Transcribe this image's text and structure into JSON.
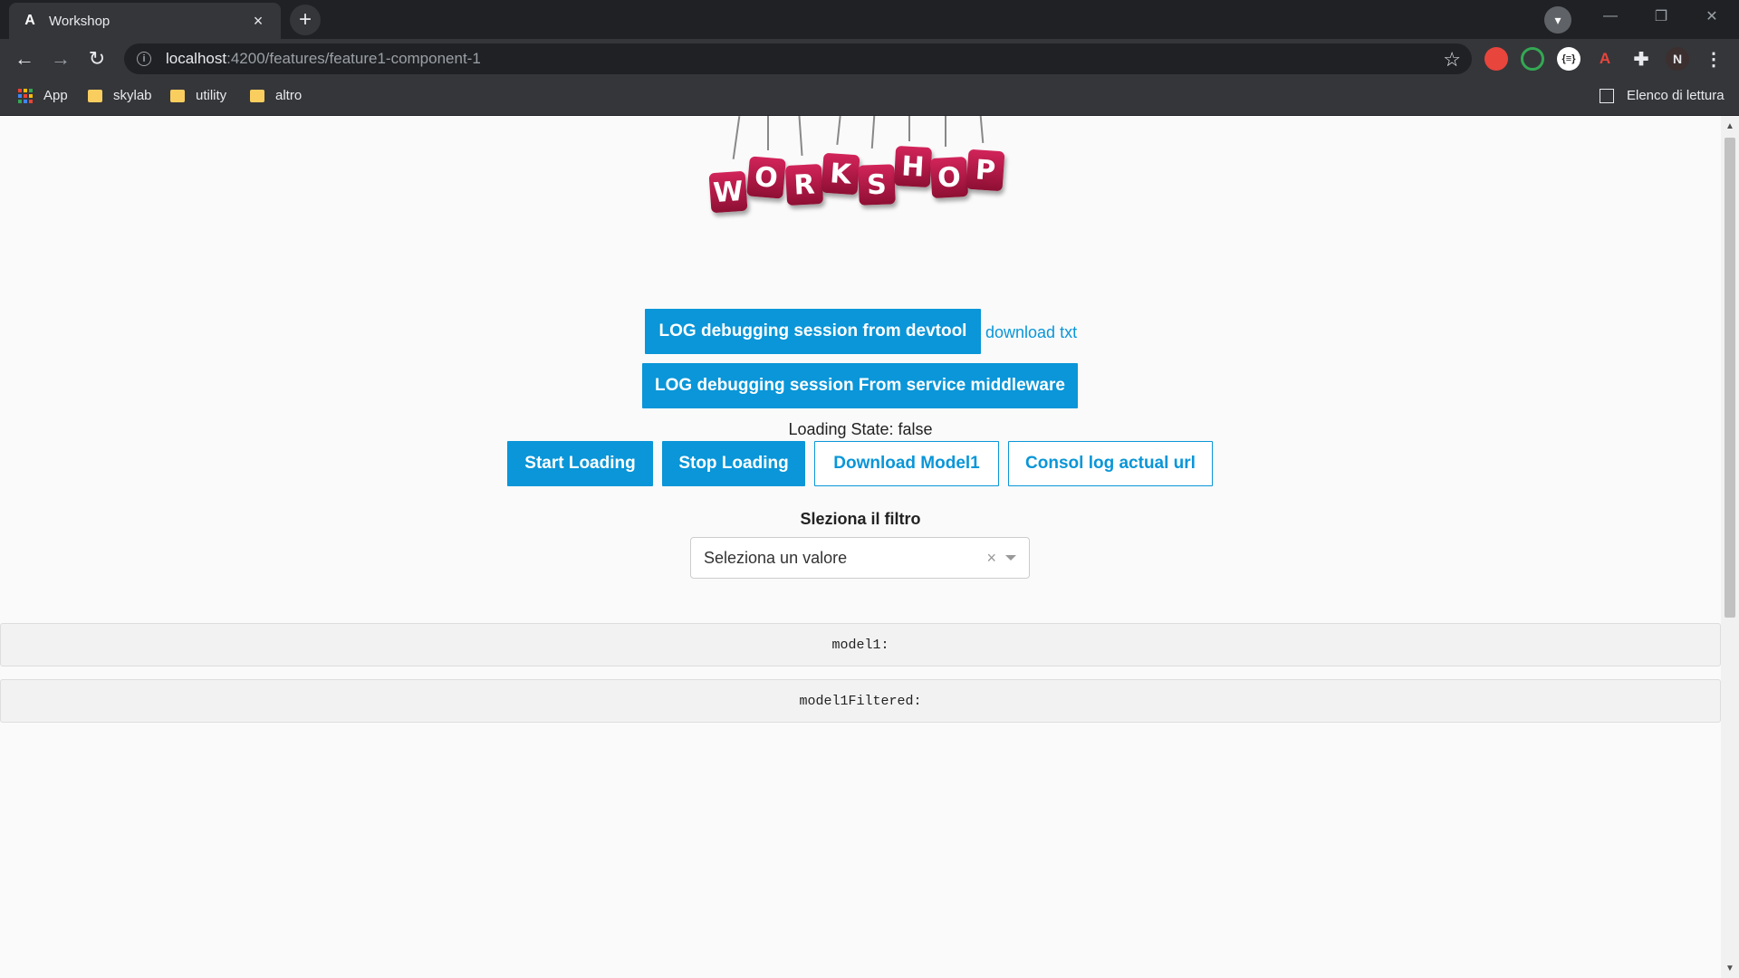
{
  "browser": {
    "tab": {
      "favicon": "A",
      "title": "Workshop",
      "close": "×"
    },
    "new_tab": "+",
    "url_host": "localhost",
    "url_path": ":4200/features/feature1-component-1",
    "extensions": [
      {
        "label": "",
        "color": "#e8453c"
      },
      {
        "label": "",
        "color": "#34a853"
      },
      {
        "label": "{≡}",
        "color": "#ffffff"
      },
      {
        "label": "A",
        "color": "#e8453c"
      },
      {
        "label": "N",
        "color": "#35363a"
      }
    ],
    "bookmarks": {
      "apps": "App",
      "items": [
        "skylab",
        "utility",
        "altro"
      ],
      "reading_list": "Elenco di lettura"
    }
  },
  "logo": {
    "letters": [
      "W",
      "O",
      "R",
      "K",
      "S",
      "H",
      "O",
      "P"
    ]
  },
  "page": {
    "log_devtool_button": "LOG debugging session from devtool",
    "download_txt_link": "download txt",
    "log_middleware_button": "LOG debugging session From service middleware",
    "loading_state": "Loading State: false",
    "start_loading": "Start Loading",
    "stop_loading": "Stop Loading",
    "download_model": "Download Model1",
    "console_log_url": "Consol log actual url",
    "filter_label": "Sleziona il filtro",
    "filter_value": "Seleziona un valore",
    "filter_clear": "×",
    "model1_panel": "model1:",
    "model1filtered_panel": "model1Filtered:"
  },
  "colors": {
    "accent": "#0a96d8",
    "logo_tile": "#c21f52",
    "chrome_dark": "#202124"
  }
}
